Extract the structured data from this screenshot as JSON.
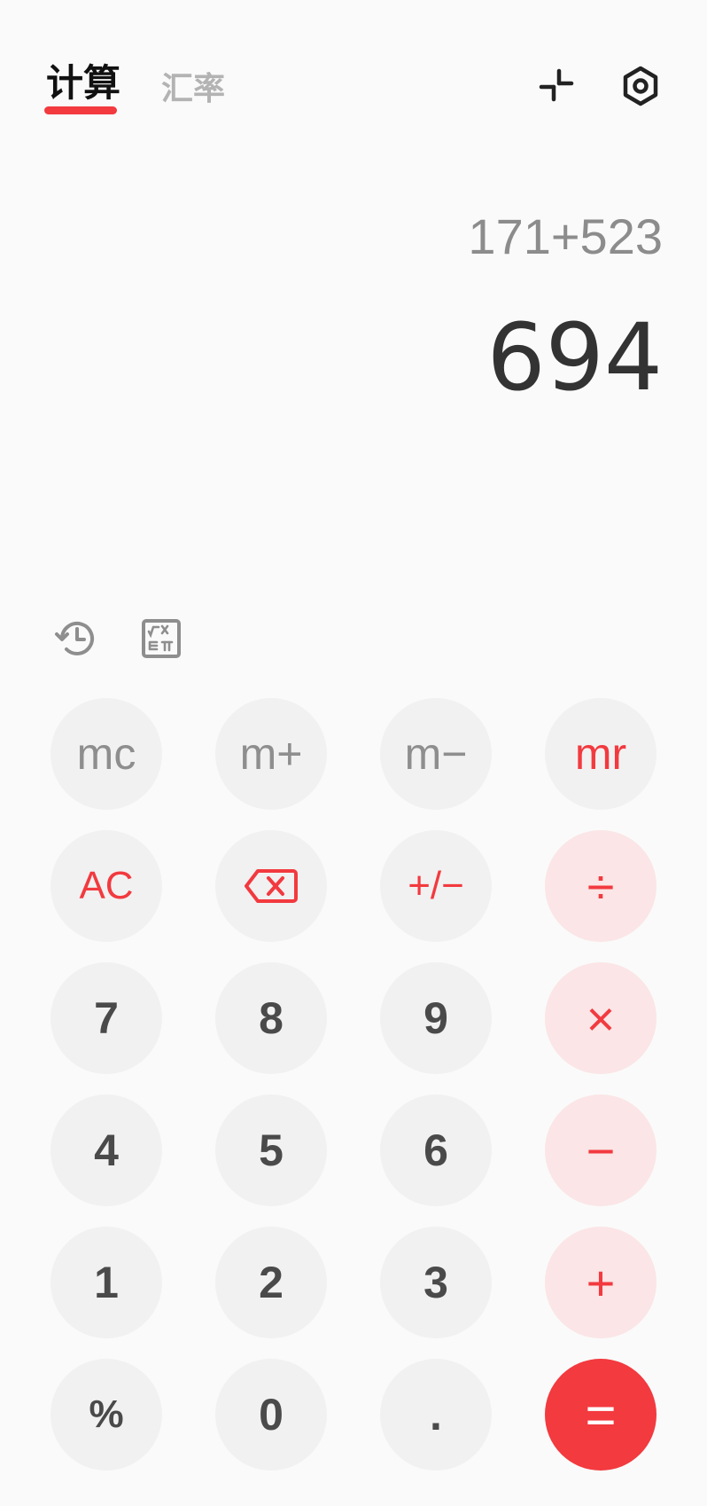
{
  "header": {
    "tabs": [
      {
        "label": "计算",
        "active": true
      },
      {
        "label": "汇率",
        "active": false
      }
    ],
    "icons": [
      "shrink-icon",
      "settings-icon"
    ]
  },
  "display": {
    "expression": "171+523",
    "result": "694"
  },
  "tools": [
    "history-icon",
    "scientific-icon"
  ],
  "keys": {
    "mc": "mc",
    "m_plus": "m+",
    "m_minus": "m−",
    "mr": "mr",
    "ac": "AC",
    "backspace_icon": "backspace-icon",
    "plus_minus": "+/−",
    "divide": "÷",
    "seven": "7",
    "eight": "8",
    "nine": "9",
    "multiply": "×",
    "four": "4",
    "five": "5",
    "six": "6",
    "minus": "−",
    "one": "1",
    "two": "2",
    "three": "3",
    "plus": "+",
    "percent": "%",
    "zero": "0",
    "dot": ".",
    "equals": "="
  },
  "colors": {
    "accent": "#f23a3f",
    "op_bg": "#fbe5e6",
    "key_bg": "#f1f1f1",
    "background": "#fafafa"
  }
}
